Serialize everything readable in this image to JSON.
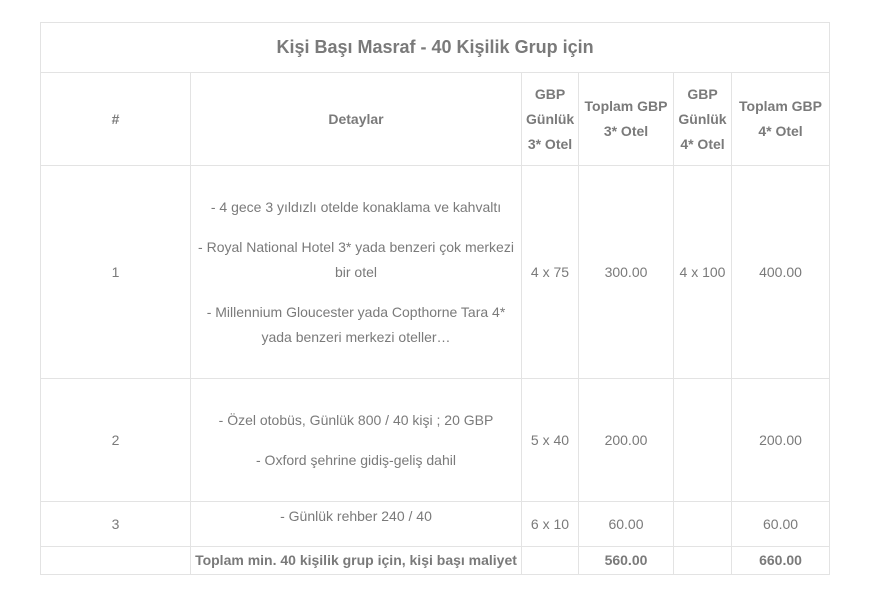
{
  "table": {
    "title": "Kişi Başı Masraf - 40 Kişilik Grup için",
    "headers": {
      "index": "#",
      "details": "Detaylar",
      "daily3_lines": [
        "GBP",
        "Günlük",
        "3* Otel"
      ],
      "total3_lines": [
        "Toplam GBP",
        "3* Otel"
      ],
      "daily4_lines": [
        "GBP",
        "Günlük",
        "4* Otel"
      ],
      "total4_lines": [
        "Toplam GBP",
        "4* Otel"
      ]
    },
    "rows": [
      {
        "index": "1",
        "details": [
          "- 4 gece 3 yıldızlı otelde konaklama ve kahvaltı",
          "- Royal National Hotel 3* yada benzeri çok merkezi bir otel",
          "- Millennium Gloucester yada Copthorne Tara 4* yada benzeri merkezi oteller…"
        ],
        "daily3": "4 x 75",
        "total3": "300.00",
        "daily4": "4 x 100",
        "total4": "400.00"
      },
      {
        "index": "2",
        "details": [
          "- Özel otobüs, Günlük 800 / 40 kişi ; 20 GBP",
          "- Oxford şehrine gidiş-geliş dahil"
        ],
        "daily3": "5 x 40",
        "total3": "200.00",
        "daily4": "",
        "total4": "200.00"
      },
      {
        "index": "3",
        "details": [
          "- Günlük rehber 240 / 40"
        ],
        "daily3": "6 x 10",
        "total3": "60.00",
        "daily4": "",
        "total4": "60.00"
      }
    ],
    "total": {
      "label": "Toplam min. 40 kişilik grup için, kişi başı maliyet",
      "total3": "560.00",
      "total4": "660.00"
    }
  }
}
